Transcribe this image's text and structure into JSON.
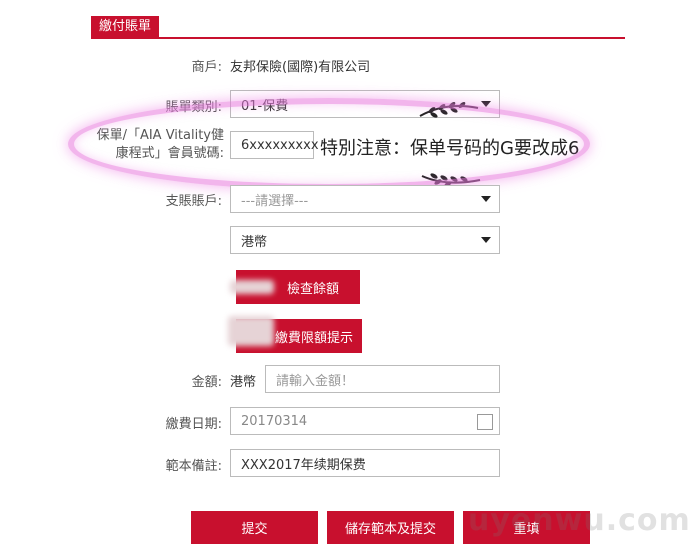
{
  "section_tab": "繳付賬單",
  "merchant": {
    "label": "商戶:",
    "value": "友邦保險(國際)有限公司"
  },
  "bill_type": {
    "label": "賬單類別:",
    "value": "01-保費"
  },
  "policy": {
    "label_line1": "保單/「AIA Vitality健",
    "label_line2": "康程式」會員號碼:",
    "value": "6xxxxxxxxx"
  },
  "annotation_note": "特別注意：保单号码的G要改成6",
  "account": {
    "label": "支賬賬戶:",
    "placeholder": "---請選擇---"
  },
  "currency_select": {
    "value": "港幣"
  },
  "check_balance_button": "檢查餘額",
  "limit_tip_button": "繳費限額提示",
  "amount": {
    "label": "金額:",
    "currency": "港幣",
    "placeholder": "請輸入金額！"
  },
  "pay_date": {
    "label": "繳費日期:",
    "value": "20170314"
  },
  "remark": {
    "label": "範本備註:",
    "value": "XXX2017年续期保费"
  },
  "buttons": {
    "submit": "提交",
    "save_submit": "儲存範本及提交",
    "reset": "重填"
  },
  "watermark": "uyenwu.com",
  "colors": {
    "accent": "#c8102e",
    "highlight": "#e878dc"
  }
}
